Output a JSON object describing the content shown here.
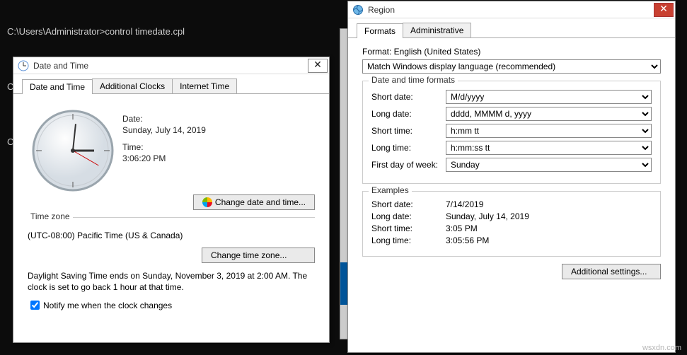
{
  "terminal": {
    "lines": [
      "C:\\Users\\Administrator>control timedate.cpl",
      "",
      "C:\\Users\\Administrator>control intl.cpl",
      "",
      "C"
    ]
  },
  "datetime_dlg": {
    "title": "Date and Time",
    "tabs": [
      "Date and Time",
      "Additional Clocks",
      "Internet Time"
    ],
    "date_label": "Date:",
    "date_value": "Sunday, July 14, 2019",
    "time_label": "Time:",
    "time_value": "3:06:20 PM",
    "change_dt_btn": "Change date and time...",
    "tz_section": "Time zone",
    "tz_value": "(UTC-08:00) Pacific Time (US & Canada)",
    "change_tz_btn": "Change time zone...",
    "dst_msg": "Daylight Saving Time ends on Sunday, November 3, 2019 at 2:00 AM. The clock is set to go back 1 hour at that time.",
    "notify_label": "Notify me when the clock changes"
  },
  "region_dlg": {
    "title": "Region",
    "tabs": [
      "Formats",
      "Administrative"
    ],
    "format_label": "Format: English (United States)",
    "format_select": "Match Windows display language (recommended)",
    "dtf_section": "Date and time formats",
    "short_date_lbl": "Short date:",
    "short_date_val": "M/d/yyyy",
    "long_date_lbl": "Long date:",
    "long_date_val": "dddd, MMMM d, yyyy",
    "short_time_lbl": "Short time:",
    "short_time_val": "h:mm tt",
    "long_time_lbl": "Long time:",
    "long_time_val": "h:mm:ss tt",
    "first_day_lbl": "First day of week:",
    "first_day_val": "Sunday",
    "examples_section": "Examples",
    "ex_short_date_lbl": "Short date:",
    "ex_short_date_val": "7/14/2019",
    "ex_long_date_lbl": "Long date:",
    "ex_long_date_val": "Sunday, July 14, 2019",
    "ex_short_time_lbl": "Short time:",
    "ex_short_time_val": "3:05 PM",
    "ex_long_time_lbl": "Long time:",
    "ex_long_time_val": "3:05:56 PM",
    "additional_btn": "Additional settings..."
  },
  "watermark": "wsxdn.com"
}
